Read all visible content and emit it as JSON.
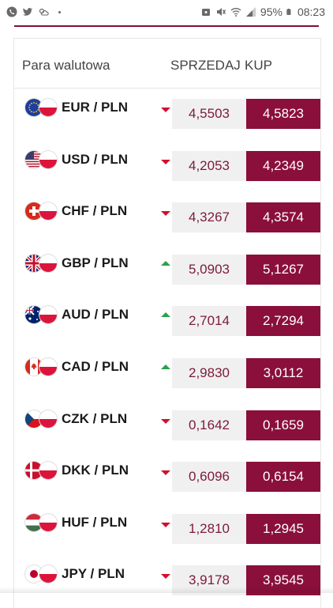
{
  "status_bar": {
    "battery": "95%",
    "time": "08:23"
  },
  "table": {
    "col_pair": "Para walutowa",
    "col_sell": "SPRZEDAJ",
    "col_buy": "KUP",
    "rows": [
      {
        "pair": "EUR / PLN",
        "trend": "down",
        "sell": "4,5503",
        "buy": "4,5823",
        "flag": "eu-flag-icon"
      },
      {
        "pair": "USD / PLN",
        "trend": "down",
        "sell": "4,2053",
        "buy": "4,2349",
        "flag": "us-flag-icon"
      },
      {
        "pair": "CHF / PLN",
        "trend": "down",
        "sell": "4,3267",
        "buy": "4,3574",
        "flag": "ch-flag-icon"
      },
      {
        "pair": "GBP / PLN",
        "trend": "up",
        "sell": "5,0903",
        "buy": "5,1267",
        "flag": "gb-flag-icon"
      },
      {
        "pair": "AUD / PLN",
        "trend": "up",
        "sell": "2,7014",
        "buy": "2,7294",
        "flag": "au-flag-icon"
      },
      {
        "pair": "CAD / PLN",
        "trend": "up",
        "sell": "2,9830",
        "buy": "3,0112",
        "flag": "ca-flag-icon"
      },
      {
        "pair": "CZK / PLN",
        "trend": "down",
        "sell": "0,1642",
        "buy": "0,1659",
        "flag": "cz-flag-icon"
      },
      {
        "pair": "DKK / PLN",
        "trend": "down",
        "sell": "0,6096",
        "buy": "0,6154",
        "flag": "dk-flag-icon"
      },
      {
        "pair": "HUF / PLN",
        "trend": "down",
        "sell": "1,2810",
        "buy": "1,2945",
        "flag": "hu-flag-icon"
      },
      {
        "pair": "JPY / PLN",
        "trend": "down",
        "sell": "3,9178",
        "buy": "3,9545",
        "flag": "jp-flag-icon"
      }
    ]
  },
  "colors": {
    "accent": "#8a0f3b",
    "down": "#d30f2c",
    "up": "#2aa14a"
  }
}
